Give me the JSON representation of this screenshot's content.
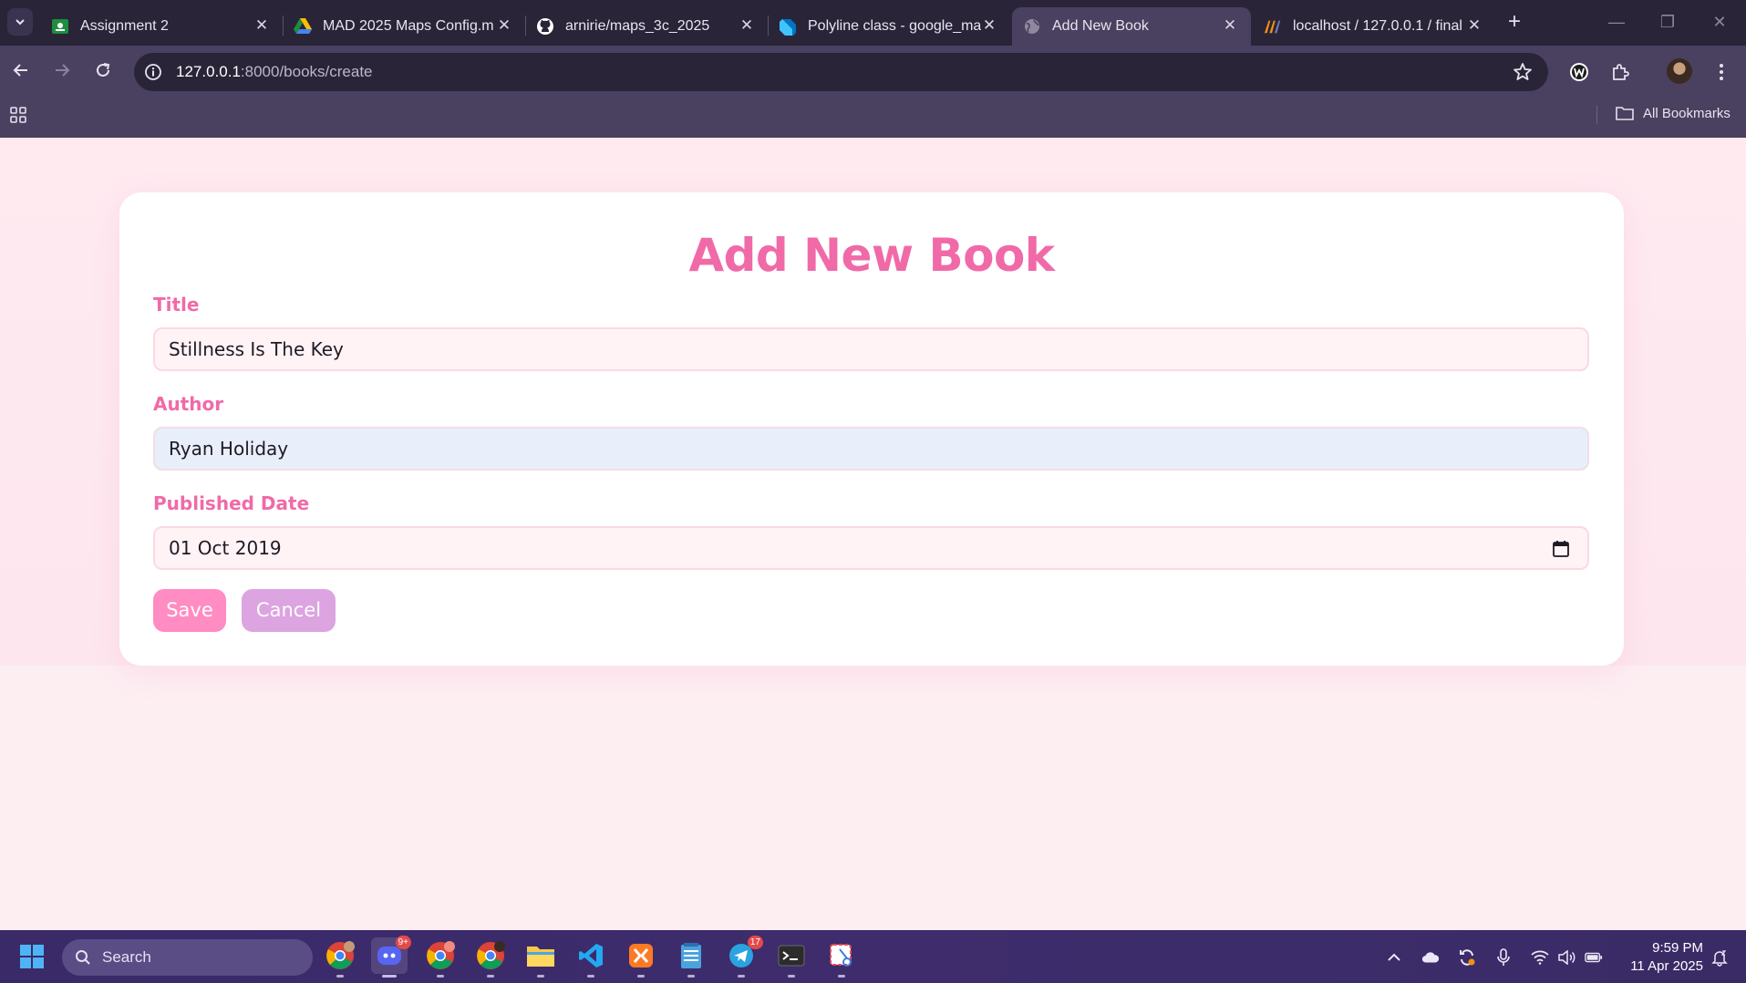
{
  "browser": {
    "tabs": [
      {
        "title": "Assignment 2",
        "icon": "google-classroom-icon"
      },
      {
        "title": "MAD 2025 Maps Config.m",
        "icon": "google-drive-icon"
      },
      {
        "title": "arnirie/maps_3c_2025",
        "icon": "github-icon"
      },
      {
        "title": "Polyline class - google_ma",
        "icon": "dart-icon"
      },
      {
        "title": "Add New Book",
        "icon": "globe-icon",
        "active": true
      },
      {
        "title": "localhost / 127.0.0.1 / final",
        "icon": "phpmyadmin-icon"
      }
    ],
    "url_host": "127.0.0.1",
    "url_path": ":8000/books/create",
    "bookmarks_label": "All Bookmarks"
  },
  "page": {
    "heading": "Add New Book",
    "fields": {
      "title": {
        "label": "Title",
        "value": "Stillness Is The Key"
      },
      "author": {
        "label": "Author",
        "value": "Ryan Holiday"
      },
      "published_date": {
        "label": "Published Date",
        "value": "01 Oct 2019"
      }
    },
    "buttons": {
      "save": "Save",
      "cancel": "Cancel"
    },
    "colors": {
      "accent": "#f06aa8",
      "save": "#ff8cc2",
      "cancel": "#dca4e0",
      "background": "#fdeef2"
    }
  },
  "taskbar": {
    "search_placeholder": "Search",
    "apps": [
      {
        "name": "chrome-profile-1"
      },
      {
        "name": "discord",
        "badge": "9+"
      },
      {
        "name": "chrome-profile-2"
      },
      {
        "name": "chrome-profile-3"
      },
      {
        "name": "file-explorer"
      },
      {
        "name": "vscode"
      },
      {
        "name": "xampp"
      },
      {
        "name": "notepad"
      },
      {
        "name": "telegram",
        "badge": "17"
      },
      {
        "name": "terminal"
      },
      {
        "name": "snipping-tool"
      }
    ],
    "time": "9:59 PM",
    "date": "11 Apr 2025"
  }
}
